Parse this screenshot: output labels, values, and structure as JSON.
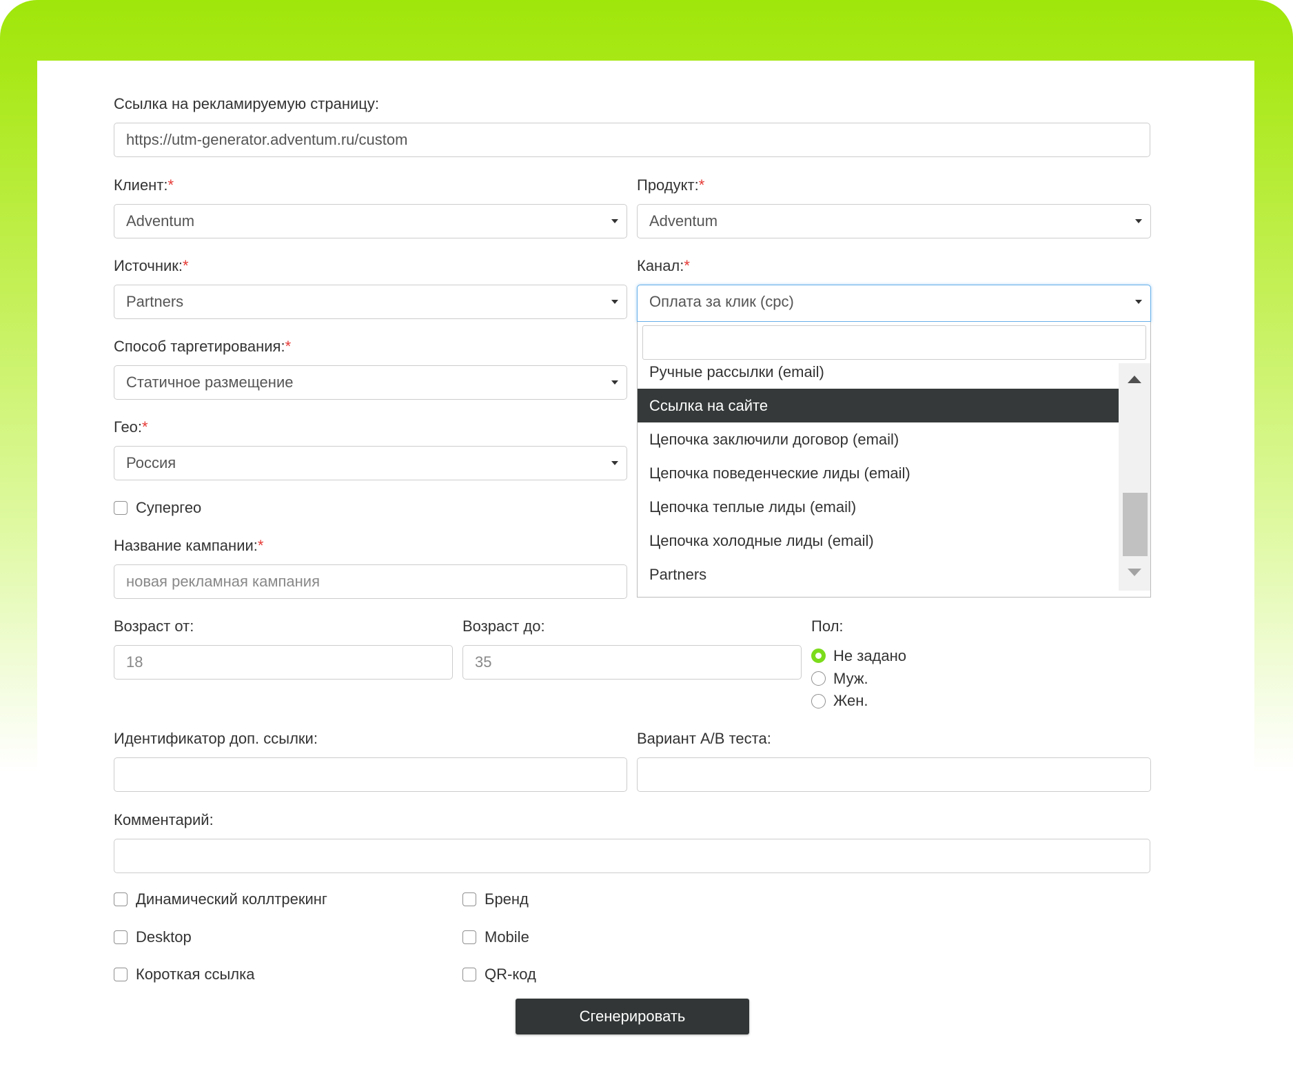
{
  "colors": {
    "accent_green": "#a8e815",
    "dark_button": "#323636",
    "required_star": "#e53935",
    "radio_checked": "#7cdc1c"
  },
  "url_field": {
    "label": "Ссылка на рекламируемую страницу:",
    "value": "https://utm-generator.adventum.ru/custom"
  },
  "client": {
    "label": "Клиент:",
    "required": "*",
    "value": "Adventum"
  },
  "product": {
    "label": "Продукт:",
    "required": "*",
    "value": "Adventum"
  },
  "source": {
    "label": "Источник:",
    "required": "*",
    "value": "Partners"
  },
  "channel": {
    "label": "Канал:",
    "required": "*",
    "value": "Оплата за клик (cpc)",
    "search_value": "",
    "options": [
      "Ручные рассылки (email)",
      "Ссылка на сайте",
      "Цепочка заключили договор (email)",
      "Цепочка поведенческие лиды (email)",
      "Цепочка теплые лиды (email)",
      "Цепочка холодные лиды (email)",
      "Partners"
    ],
    "highlighted": "Ссылка на сайте"
  },
  "targeting": {
    "label": "Способ таргетирования:",
    "required": "*",
    "value": "Статичное размещение"
  },
  "geo": {
    "label": "Гео:",
    "required": "*",
    "value": "Россия"
  },
  "supergeo": {
    "label": "Супергео",
    "checked": false
  },
  "campaign": {
    "label": "Название кампании:",
    "required": "*",
    "placeholder": "новая рекламная кампания"
  },
  "age_from": {
    "label": "Возраст от:",
    "placeholder": "18"
  },
  "age_to": {
    "label": "Возраст до:",
    "placeholder": "35"
  },
  "gender": {
    "label": "Пол:",
    "options": [
      "Не задано",
      "Муж.",
      "Жен."
    ],
    "selected": "Не задано"
  },
  "extra_link_id": {
    "label": "Идентификатор доп. ссылки:",
    "value": ""
  },
  "ab_variant": {
    "label": "Вариант A/B теста:",
    "value": ""
  },
  "comment": {
    "label": "Комментарий:",
    "value": ""
  },
  "checkboxes": [
    {
      "label": "Динамический коллтрекинг",
      "checked": false
    },
    {
      "label": "Бренд",
      "checked": false
    },
    {
      "label": "Desktop",
      "checked": false
    },
    {
      "label": "Mobile",
      "checked": false
    },
    {
      "label": "Короткая ссылка",
      "checked": false
    },
    {
      "label": "QR-код",
      "checked": false
    }
  ],
  "submit_label": "Сгенерировать"
}
